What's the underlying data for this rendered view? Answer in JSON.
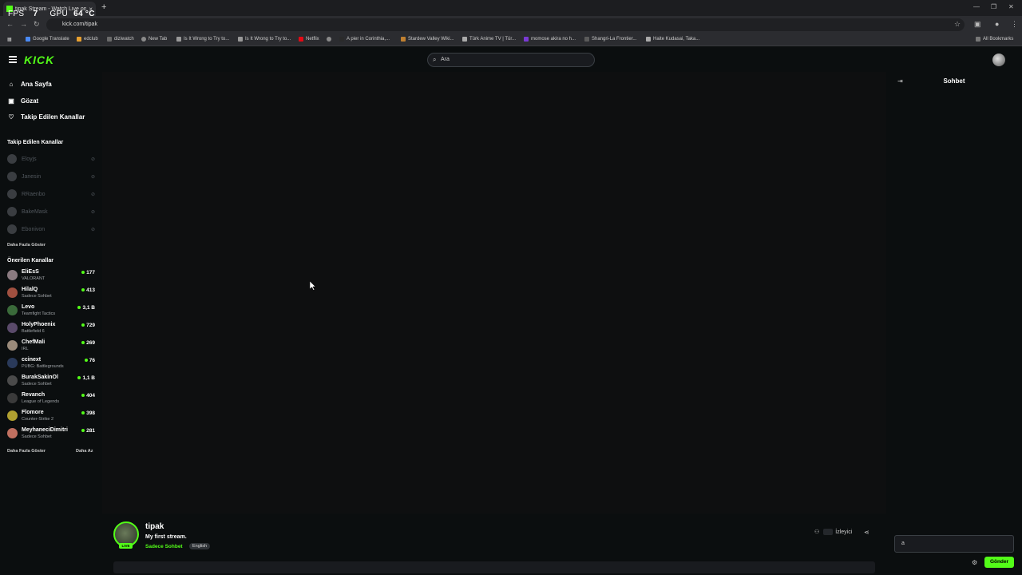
{
  "browser": {
    "tab_title": "tipak Stream - Watch Live on K",
    "url": "kick.com/tipak",
    "bookmarks": [
      "Google Translate",
      "edclub",
      "diziwatch",
      "New Tab",
      "Is It Wrong to Try to...",
      "Is It Wrong to Try to...",
      "Netflix",
      "",
      "A pier in Corinthia,...",
      "Stardew Valley Wiki...",
      "Türk Anime TV | Tür...",
      "momose akira no h...",
      "Shangri-La Frontier...",
      "Haite Kudasai, Taka..."
    ],
    "all_bookmarks": "All Bookmarks"
  },
  "overlay": {
    "fps_label": "FPS",
    "fps_value": "7",
    "gpu_label": "GPU",
    "gpu_value": "64 °C"
  },
  "header": {
    "logo": "KICK",
    "search_placeholder": "Ara"
  },
  "sidebar": {
    "nav": [
      {
        "label": "Ana Sayfa",
        "icon": "home-icon"
      },
      {
        "label": "Gözat",
        "icon": "browse-icon"
      },
      {
        "label": "Takip Edilen Kanallar",
        "icon": "heart-icon"
      }
    ],
    "followed_title": "Takip Edilen Kanallar",
    "followed": [
      "Eloyjs",
      "Janesin",
      "RRaenbo",
      "BakeMask",
      "Ebonivon"
    ],
    "show_more": "Daha Fazla Göster",
    "recommended_title": "Önerilen Kanallar",
    "recommended": [
      {
        "name": "EliEsS",
        "category": "VALORANT",
        "viewers": "177",
        "color": "#8a7a80"
      },
      {
        "name": "HilalQ",
        "category": "Sadece Sohbet",
        "viewers": "413",
        "color": "#a05040"
      },
      {
        "name": "Levo",
        "category": "Teamfight Tactics",
        "viewers": "3,1 B",
        "color": "#3a6a3a"
      },
      {
        "name": "HolyPhoenix",
        "category": "Battlefield 6",
        "viewers": "729",
        "color": "#5a4a6a"
      },
      {
        "name": "ChefMali",
        "category": "IRL",
        "viewers": "269",
        "color": "#9a8a7a"
      },
      {
        "name": "ccinext",
        "category": "PUBG: Battlegrounds",
        "viewers": "76",
        "color": "#2a3a5a"
      },
      {
        "name": "BurakSakinOl",
        "category": "Sadece Sohbet",
        "viewers": "1,1 B",
        "color": "#4a4a4a"
      },
      {
        "name": "Revanch",
        "category": "League of Legends",
        "viewers": "404",
        "color": "#3a3a3a"
      },
      {
        "name": "Flomore",
        "category": "Counter-Strike 2",
        "viewers": "398",
        "color": "#b0a030"
      },
      {
        "name": "MeyhaneciDimitri",
        "category": "Sadece Sohbet",
        "viewers": "281",
        "color": "#c07060"
      }
    ],
    "show_more_2": "Daha Fazla Göster",
    "show_less": "Daha Az"
  },
  "channel": {
    "name": "tipak",
    "title": "My first stream.",
    "category": "Sadece Sohbet",
    "tag": "English",
    "live_badge": "LIVE",
    "viewers_label": "İzleyici"
  },
  "chat": {
    "title": "Sohbet",
    "input_value": "a",
    "send_label": "Gönder"
  },
  "colors": {
    "accent": "#53fc18",
    "background": "#0b0e0f",
    "player": "#0e0f10"
  }
}
